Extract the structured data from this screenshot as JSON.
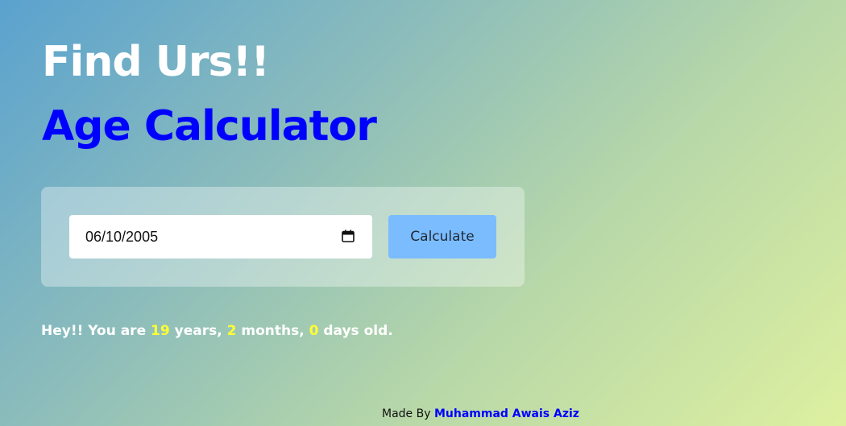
{
  "header": {
    "title": "Find Urs!!",
    "subtitle": "Age Calculator"
  },
  "form": {
    "date_value": "06/10/2005",
    "calendar_icon": "calendar-icon",
    "calculate_label": "Calculate"
  },
  "result": {
    "prefix": "Hey!! You are ",
    "years": "19",
    "years_label": " years, ",
    "months": "2",
    "months_label": " months, ",
    "days": "0",
    "days_label": " days old."
  },
  "footer": {
    "made_by_label": "Made By ",
    "author": "Muhammad Awais Aziz"
  },
  "colors": {
    "title": "#ffffff",
    "subtitle": "#0000ff",
    "highlight": "#ffff33",
    "button": "#7bbcff",
    "author": "#0000ff"
  }
}
